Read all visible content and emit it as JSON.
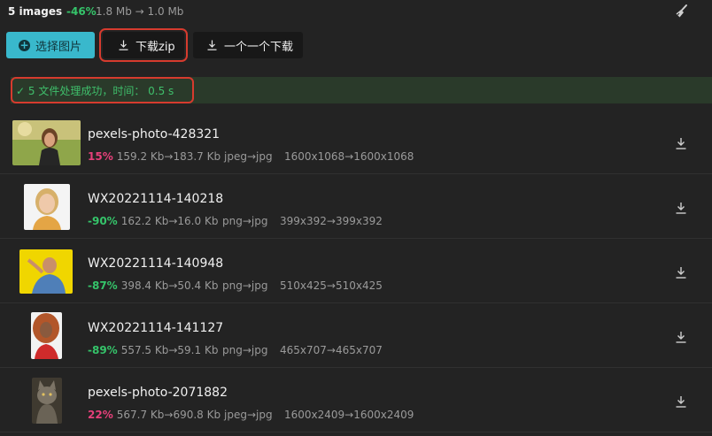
{
  "summary": {
    "count": "5 images",
    "percent": "-46%",
    "sizes": "1.8 Mb → 1.0 Mb"
  },
  "buttons": {
    "select": "选择图片",
    "zip": "下载zip",
    "each": "一个一个下载"
  },
  "status": {
    "message": "✓ 5 文件处理成功，时间： 0.5 s"
  },
  "files": [
    {
      "name": "pexels-photo-428321",
      "percent": "15%",
      "trend": "up",
      "sizes": "159.2 Kb→183.7 Kb",
      "conversion": "jpeg→jpg",
      "dimensions": "1600x1068→1600x1068"
    },
    {
      "name": "WX20221114-140218",
      "percent": "-90%",
      "trend": "down",
      "sizes": "162.2 Kb→16.0 Kb",
      "conversion": "png→jpg",
      "dimensions": "399x392→399x392"
    },
    {
      "name": "WX20221114-140948",
      "percent": "-87%",
      "trend": "down",
      "sizes": "398.4 Kb→50.4 Kb",
      "conversion": "png→jpg",
      "dimensions": "510x425→510x425"
    },
    {
      "name": "WX20221114-141127",
      "percent": "-89%",
      "trend": "down",
      "sizes": "557.5 Kb→59.1 Kb",
      "conversion": "png→jpg",
      "dimensions": "465x707→465x707"
    },
    {
      "name": "pexels-photo-2071882",
      "percent": "22%",
      "trend": "up",
      "sizes": "567.7 Kb→690.8 Kb",
      "conversion": "jpeg→jpg",
      "dimensions": "1600x2409→1600x2409"
    }
  ],
  "colors": {
    "accent": "#39b8cc",
    "success": "#3fbf6b",
    "increase": "#e6407a",
    "decrease": "#35c46a",
    "highlight": "#d63b2e"
  },
  "icons": [
    "broom-icon",
    "plus-circle-icon",
    "download-icon"
  ]
}
